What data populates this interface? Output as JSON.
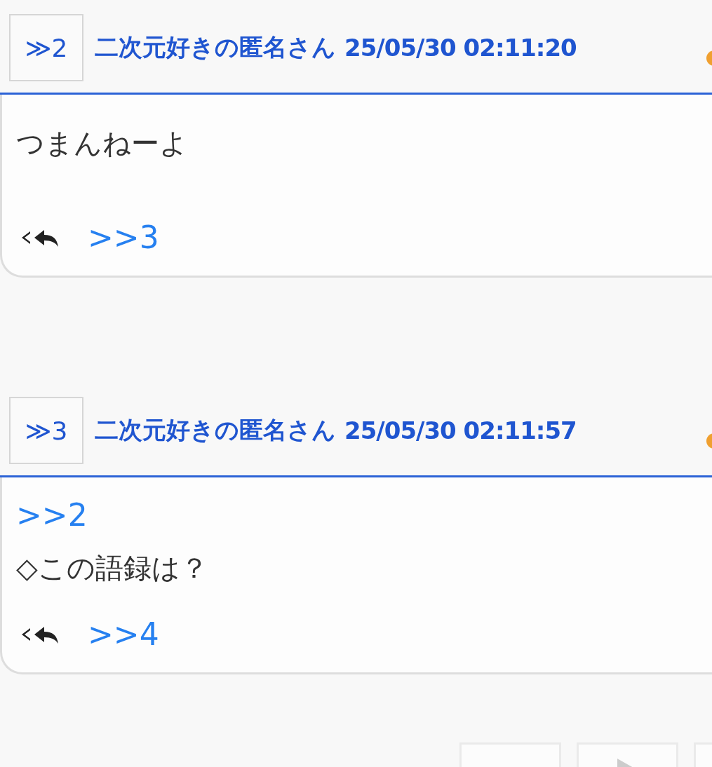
{
  "posts": [
    {
      "number": "≫2",
      "name": "二次元好きの匿名さん",
      "date": "25/05/30 02:11:20",
      "body": [
        {
          "kind": "text",
          "text": "つまんねーよ"
        }
      ],
      "replies": [
        ">>3"
      ]
    },
    {
      "number": "≫3",
      "name": "二次元好きの匿名さん",
      "date": "25/05/30 02:11:57",
      "body": [
        {
          "kind": "anchor",
          "text": ">>2"
        },
        {
          "kind": "text",
          "text": "◇この語録は？"
        }
      ],
      "replies": [
        ">>4"
      ]
    }
  ]
}
